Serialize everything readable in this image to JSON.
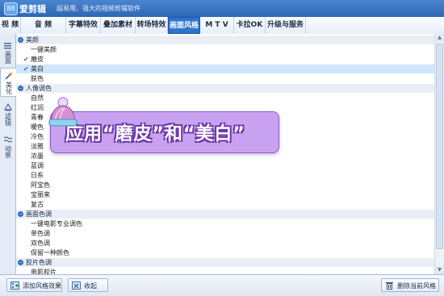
{
  "app": {
    "name": "爱剪辑",
    "tagline": "超易用、强大的视频剪辑软件",
    "logo_text": "88"
  },
  "tabs": [
    {
      "label": "视 频"
    },
    {
      "label": "音 频"
    },
    {
      "label": "字幕特效"
    },
    {
      "label": "叠加素材"
    },
    {
      "label": "转场特效"
    },
    {
      "label": "画面风格",
      "active": true
    },
    {
      "label": "M T V"
    },
    {
      "label": "卡拉OK"
    },
    {
      "label": "升级与服务"
    }
  ],
  "side_tabs": [
    {
      "label": "画面",
      "icon": "lines-icon"
    },
    {
      "label": "美化",
      "icon": "magic-wand-icon",
      "active": true
    },
    {
      "label": "滤镜",
      "icon": "filter-icon"
    },
    {
      "label": "动景",
      "icon": "wave-icon"
    }
  ],
  "list": [
    {
      "type": "header",
      "label": "美颜"
    },
    {
      "type": "item",
      "label": "一键美颜"
    },
    {
      "type": "item",
      "label": "磨皮",
      "checked": true
    },
    {
      "type": "item",
      "label": "美白",
      "checked": true,
      "selected": true
    },
    {
      "type": "item",
      "label": "肤色"
    },
    {
      "type": "header",
      "label": "人像调色"
    },
    {
      "type": "item",
      "label": "自然"
    },
    {
      "type": "item",
      "label": "红润"
    },
    {
      "type": "item",
      "label": "青春"
    },
    {
      "type": "item",
      "label": "暖色"
    },
    {
      "type": "item",
      "label": "冷色"
    },
    {
      "type": "item",
      "label": "淡雅"
    },
    {
      "type": "item",
      "label": "浓墨"
    },
    {
      "type": "item",
      "label": "蓝调"
    },
    {
      "type": "item",
      "label": "日系"
    },
    {
      "type": "item",
      "label": "阿宝色"
    },
    {
      "type": "item",
      "label": "宝丽来"
    },
    {
      "type": "item",
      "label": "复古"
    },
    {
      "type": "header",
      "label": "画面色调"
    },
    {
      "type": "item",
      "label": "一键电影专业调色"
    },
    {
      "type": "item",
      "label": "单色调"
    },
    {
      "type": "item",
      "label": "双色调"
    },
    {
      "type": "item",
      "label": "保留一种颜色"
    },
    {
      "type": "header",
      "label": "胶片色调"
    },
    {
      "type": "item",
      "label": "电影胶片"
    }
  ],
  "banner": {
    "text": "应用“磨皮”和“美白”"
  },
  "buttons": {
    "add_style": "添加风格效果",
    "collapse": "收起",
    "delete_style": "删除当前风格"
  },
  "colors": {
    "accent": "#2f73cf",
    "selection": "#cfe5fb",
    "banner_fill": "#c9a2f1",
    "banner_outline": "#6d3aa8"
  }
}
